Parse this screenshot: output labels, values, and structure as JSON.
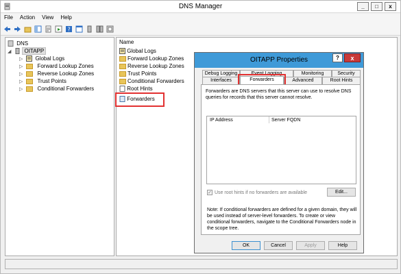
{
  "window": {
    "title": "DNS Manager",
    "minimize": "_",
    "maximize": "□",
    "close": "x"
  },
  "menubar": {
    "items": [
      "File",
      "Action",
      "View",
      "Help"
    ]
  },
  "tree": {
    "root": "DNS",
    "server": "OITAPP",
    "children": [
      "Global Logs",
      "Forward Lookup Zones",
      "Reverse Lookup Zones",
      "Trust Points",
      "Conditional Forwarders"
    ]
  },
  "list": {
    "column_header": "Name",
    "items": [
      "Global Logs",
      "Forward Lookup Zones",
      "Reverse Lookup Zones",
      "Trust Points",
      "Conditional Forwarders",
      "Root Hints",
      "Forwarders"
    ]
  },
  "dialog": {
    "title": "OITAPP Properties",
    "help": "?",
    "close": "x",
    "tabs_row1": [
      "Debug Logging",
      "Event Logging",
      "Monitoring",
      "Security"
    ],
    "tabs_row2": [
      "Interfaces",
      "Forwarders",
      "Advanced",
      "Root Hints"
    ],
    "description": "Forwarders are DNS servers that this server can use to resolve DNS queries for records that this server cannot resolve.",
    "grid_headers": [
      "IP Address",
      "Server FQDN"
    ],
    "checkbox_label": "Use root hints if no forwarders are available",
    "checkbox_mark": "✓",
    "edit_button": "Edit...",
    "note": "Note: If conditional forwarders are defined for a given domain, they will be used instead of server-level forwarders. To create or view conditional forwarders, navigate to the Conditional Forwarders node in the scope tree.",
    "buttons": [
      "OK",
      "Cancel",
      "Apply",
      "Help"
    ]
  },
  "colors": {
    "dialog_title_bar": "#3f9ad8",
    "close_button": "#c83a3a",
    "highlight_box": "#e23030"
  }
}
